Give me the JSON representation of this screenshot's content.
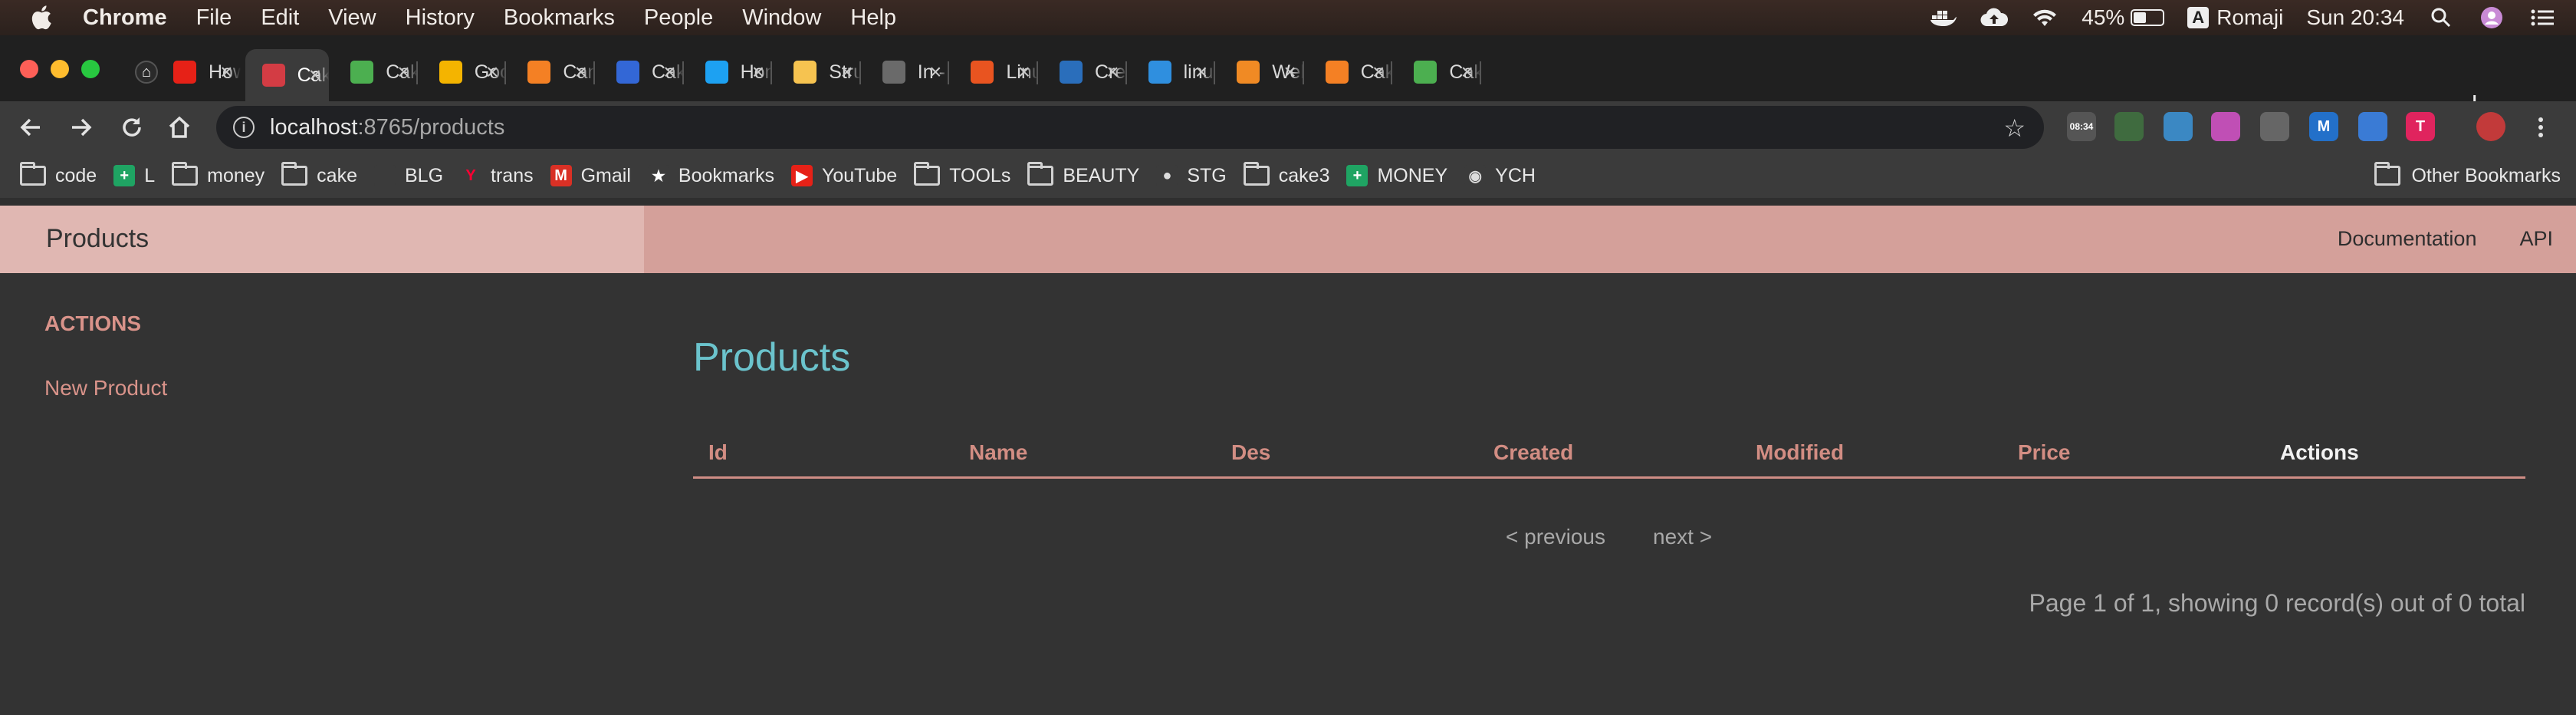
{
  "menubar": {
    "app": "Chrome",
    "items": [
      "File",
      "Edit",
      "View",
      "History",
      "Bookmarks",
      "People",
      "Window",
      "Help"
    ],
    "battery_pct": "45%",
    "battery_level": 0.45,
    "input_source": "Romaji",
    "input_badge": "A",
    "clock": "Sun 20:34",
    "icons": [
      "docker-icon",
      "cloud-upload-icon",
      "wifi-icon",
      "battery-icon",
      "search-icon",
      "user-icon",
      "list-icon"
    ]
  },
  "tabs": [
    {
      "title": "",
      "icon": "github-icon",
      "color": "#202020"
    },
    {
      "title": "How to",
      "icon": "youtube-icon",
      "color": "#e62117"
    },
    {
      "title": "CakePHP",
      "icon": "cakephp-icon",
      "color": "#d33c44",
      "active": true
    },
    {
      "title": "CakePHP",
      "icon": "forum-icon",
      "color": "#4caf50"
    },
    {
      "title": "Google",
      "icon": "bulb-icon",
      "color": "#f4b400"
    },
    {
      "title": "Cannot",
      "icon": "stackoverflow-icon",
      "color": "#f48024"
    },
    {
      "title": "CakePHP",
      "icon": "flask-icon",
      "color": "#3367d6"
    },
    {
      "title": "Home",
      "icon": "twitter-icon",
      "color": "#1da1f2"
    },
    {
      "title": "Struggle",
      "icon": "envelope-icon",
      "color": "#f6c350"
    },
    {
      "title": "In - In",
      "icon": "globe-icon",
      "color": "#6a6a6a"
    },
    {
      "title": "Linux",
      "icon": "ubuntu-icon",
      "color": "#e95420"
    },
    {
      "title": "Create",
      "icon": "faq-icon",
      "color": "#2a6ebb"
    },
    {
      "title": "linux -",
      "icon": "brace-icon",
      "color": "#2f8fdf"
    },
    {
      "title": "Weblio",
      "icon": "weblio-icon",
      "color": "#f08a24"
    },
    {
      "title": "CakePHP",
      "icon": "stackoverflow-icon",
      "color": "#f48024"
    },
    {
      "title": "CakePHP",
      "icon": "forum-icon",
      "color": "#4caf50"
    }
  ],
  "toolbar": {
    "url_host": "localhost",
    "url_path": ":8765/products",
    "extensions": [
      {
        "name": "clock-extension-icon",
        "color": "#555555",
        "label": "08:34"
      },
      {
        "name": "plug-extension-icon",
        "color": "#3f6b3f",
        "label": ""
      },
      {
        "name": "feather-extension-icon",
        "color": "#3b88c3",
        "label": ""
      },
      {
        "name": "color-wheel-extension-icon",
        "color": "#c04fb5",
        "label": ""
      },
      {
        "name": "drive-extension-icon",
        "color": "#666666",
        "label": ""
      },
      {
        "name": "m-extension-icon",
        "color": "#2370c9",
        "label": "M"
      },
      {
        "name": "compass-extension-icon",
        "color": "#3a7bd5",
        "label": ""
      },
      {
        "name": "t-extension-icon",
        "color": "#e0245e",
        "label": "T"
      },
      {
        "name": "profile-avatar-icon",
        "color": "#c23a3a",
        "label": ""
      }
    ]
  },
  "bookmarks": [
    {
      "label": "code",
      "type": "folder"
    },
    {
      "label": "L",
      "type": "icon",
      "icon": "sheets-icon",
      "color": "#1fa463"
    },
    {
      "label": "money",
      "type": "folder"
    },
    {
      "label": "cake",
      "type": "folder"
    },
    {
      "label": "BLG",
      "type": "icon",
      "icon": "blank-icon",
      "color": "#3b3b3b"
    },
    {
      "label": "trans",
      "type": "icon",
      "icon": "yahoo-icon",
      "color": "#ff0033"
    },
    {
      "label": "Gmail",
      "type": "icon",
      "icon": "gmail-icon",
      "color": "#d93025"
    },
    {
      "label": "Bookmarks",
      "type": "icon",
      "icon": "star-icon",
      "color": "#3b3b3b"
    },
    {
      "label": "YouTube",
      "type": "icon",
      "icon": "youtube-icon",
      "color": "#e62117"
    },
    {
      "label": "TOOLs",
      "type": "folder"
    },
    {
      "label": "BEAUTY",
      "type": "folder"
    },
    {
      "label": "STG",
      "type": "icon",
      "icon": "github-icon",
      "color": "#3b3b3b"
    },
    {
      "label": "cake3",
      "type": "folder"
    },
    {
      "label": "MONEY",
      "type": "icon",
      "icon": "sheets-icon",
      "color": "#1fa463"
    },
    {
      "label": "YCH",
      "type": "icon",
      "icon": "globe-icon",
      "color": "#3b3b3b"
    }
  ],
  "other_bookmarks": "Other Bookmarks",
  "app": {
    "brand": "Products",
    "nav_links": [
      "Documentation",
      "API"
    ],
    "sidebar_heading": "ACTIONS",
    "sidebar_link": "New Product",
    "title": "Products",
    "columns": [
      "Id",
      "Name",
      "Des",
      "Created",
      "Modified",
      "Price",
      "Actions"
    ],
    "pager_prev": "< previous",
    "pager_next": "next >",
    "counter": "Page 1 of 1, showing 0 record(s) out of 0 total"
  },
  "colors": {
    "accent": "#d9938a",
    "title": "#6bc3cc",
    "nav_bg": "#d4a09a",
    "brand_bg": "#e0b7b2"
  }
}
